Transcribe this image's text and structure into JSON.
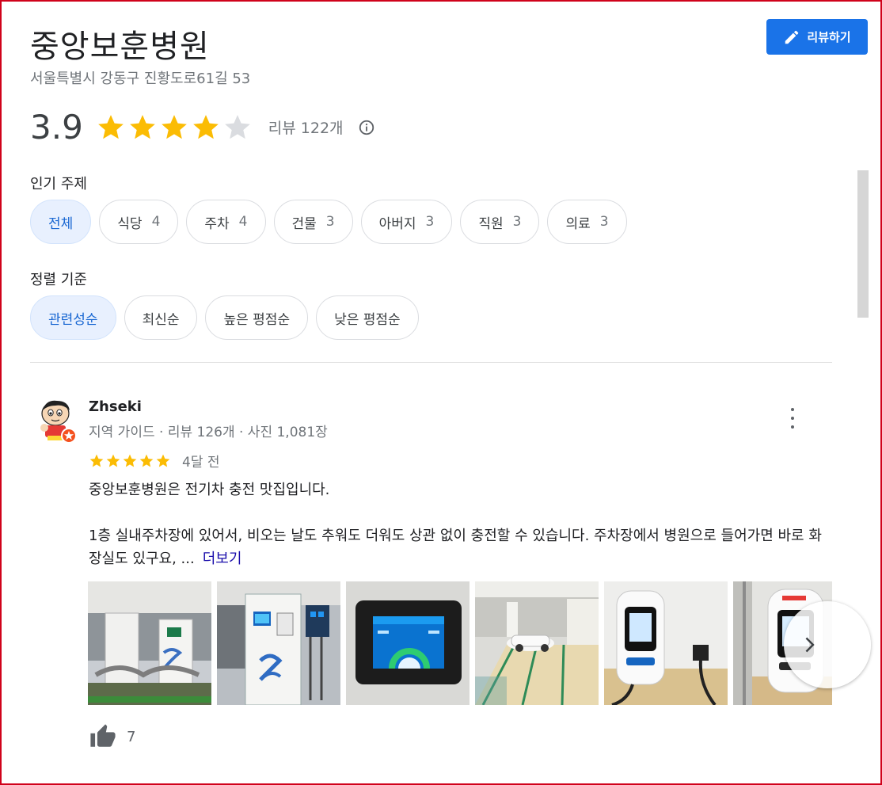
{
  "place": {
    "name": "중앙보훈병원",
    "address": "서울특별시 강동구 진황도로61길 53"
  },
  "write_review_label": "리뷰하기",
  "rating": {
    "value": "3.9",
    "stars_filled_fraction": 0.78,
    "review_count_label": "리뷰 122개"
  },
  "topics": {
    "label": "인기 주제",
    "chips": [
      {
        "label": "전체",
        "count": ""
      },
      {
        "label": "식당",
        "count": "4"
      },
      {
        "label": "주차",
        "count": "4"
      },
      {
        "label": "건물",
        "count": "3"
      },
      {
        "label": "아버지",
        "count": "3"
      },
      {
        "label": "직원",
        "count": "3"
      },
      {
        "label": "의료",
        "count": "3"
      }
    ]
  },
  "sort": {
    "label": "정렬 기준",
    "chips": [
      {
        "label": "관련성순"
      },
      {
        "label": "최신순"
      },
      {
        "label": "높은 평점순"
      },
      {
        "label": "낮은 평점순"
      }
    ]
  },
  "review": {
    "author": "Zhseki",
    "meta": "지역 가이드 · 리뷰 126개 · 사진 1,081장",
    "stars": 5,
    "date": "4달 전",
    "line1": "중앙보훈병원은 전기차 충전 맛집입니다.",
    "line2": "1층 실내주차장에 있어서, 비오는 날도 추워도 더워도 상관 없이 충전할 수 있습니다. 주차장에서 병원으로 들어가면 바로 화장실도 있구요, ...",
    "more_label": "더보기",
    "likes": "7"
  },
  "colors": {
    "accent": "#1a73e8",
    "star": "#fbbc04",
    "star_empty": "#dadce0",
    "chip_active_bg": "#e8f0fe",
    "chip_active_text": "#1967d2"
  },
  "icons": {
    "write_review": "pencil-icon",
    "info": "info-icon",
    "more": "more-vert-icon",
    "next": "chevron-right-icon",
    "like": "thumb-up-icon"
  }
}
